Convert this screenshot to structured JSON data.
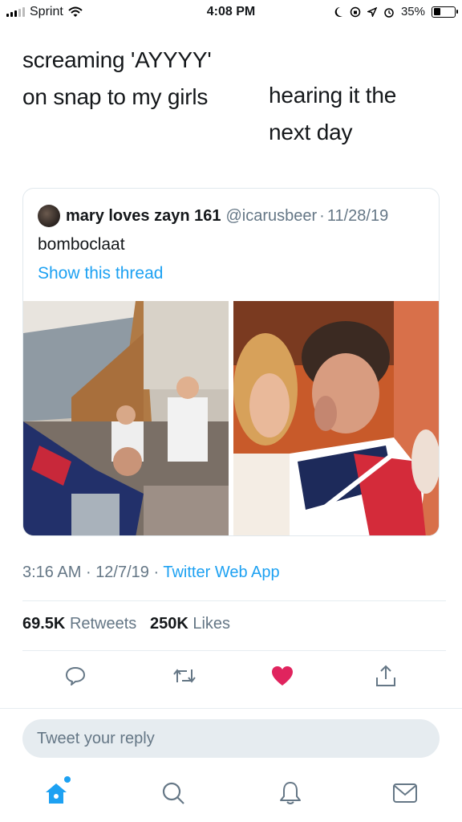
{
  "status_bar": {
    "carrier": "Sprint",
    "time": "4:08 PM",
    "battery": "35%",
    "battery_level": 0.35
  },
  "meme": {
    "left_line1": "screaming 'AYYYY'",
    "left_line2": "on snap to my girls",
    "right_line1": "hearing it the",
    "right_line2": "next day"
  },
  "quoted_tweet": {
    "name": "mary loves zayn 161",
    "handle": "@icarusbeer",
    "separator": "·",
    "date": "11/28/19",
    "text": "bomboclaat",
    "show_thread": "Show this thread"
  },
  "tweet_meta": {
    "time": "3:16 AM",
    "sep1": "·",
    "date": "12/7/19",
    "sep2": "·",
    "source": "Twitter Web App"
  },
  "stats": {
    "retweets_count": "69.5K",
    "retweets_label": "Retweets",
    "likes_count": "250K",
    "likes_label": "Likes"
  },
  "actions": {
    "reply_icon": "reply-icon",
    "retweet_icon": "retweet-icon",
    "like_icon": "heart-icon",
    "share_icon": "share-icon",
    "liked_color": "#e0245e",
    "icon_color": "#657786"
  },
  "reply": {
    "placeholder": "Tweet your reply"
  },
  "tab_bar": {
    "home_icon": "home-icon",
    "search_icon": "search-icon",
    "notifications_icon": "bell-icon",
    "messages_icon": "mail-icon",
    "accent": "#1da1f2"
  }
}
